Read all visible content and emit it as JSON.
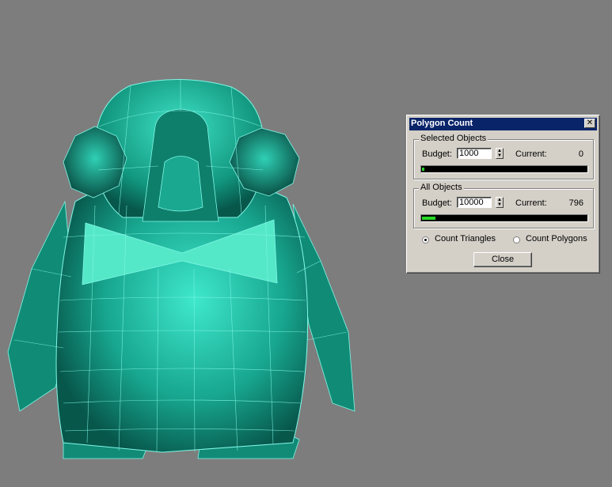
{
  "dialog": {
    "title": "Polygon Count",
    "close_glyph": "✕",
    "selected": {
      "group_label": "Selected Objects",
      "budget_label": "Budget:",
      "budget_value": "1000",
      "current_label": "Current:",
      "current_value": "0",
      "fill_fraction": 0.01
    },
    "all": {
      "group_label": "All Objects",
      "budget_label": "Budget:",
      "budget_value": "10000",
      "current_label": "Current:",
      "current_value": "796",
      "fill_fraction": 0.08
    },
    "radio_triangles": "Count Triangles",
    "radio_polygons": "Count Polygons",
    "selected_mode": "triangles",
    "close_label": "Close"
  },
  "colors": {
    "viewport_bg": "#7d7d7d",
    "model_fill": "#1fa891",
    "wire": "#7ff7e6",
    "bow": "#55e8c8",
    "titlebar": "#0a246a",
    "progress": "#27d827"
  }
}
